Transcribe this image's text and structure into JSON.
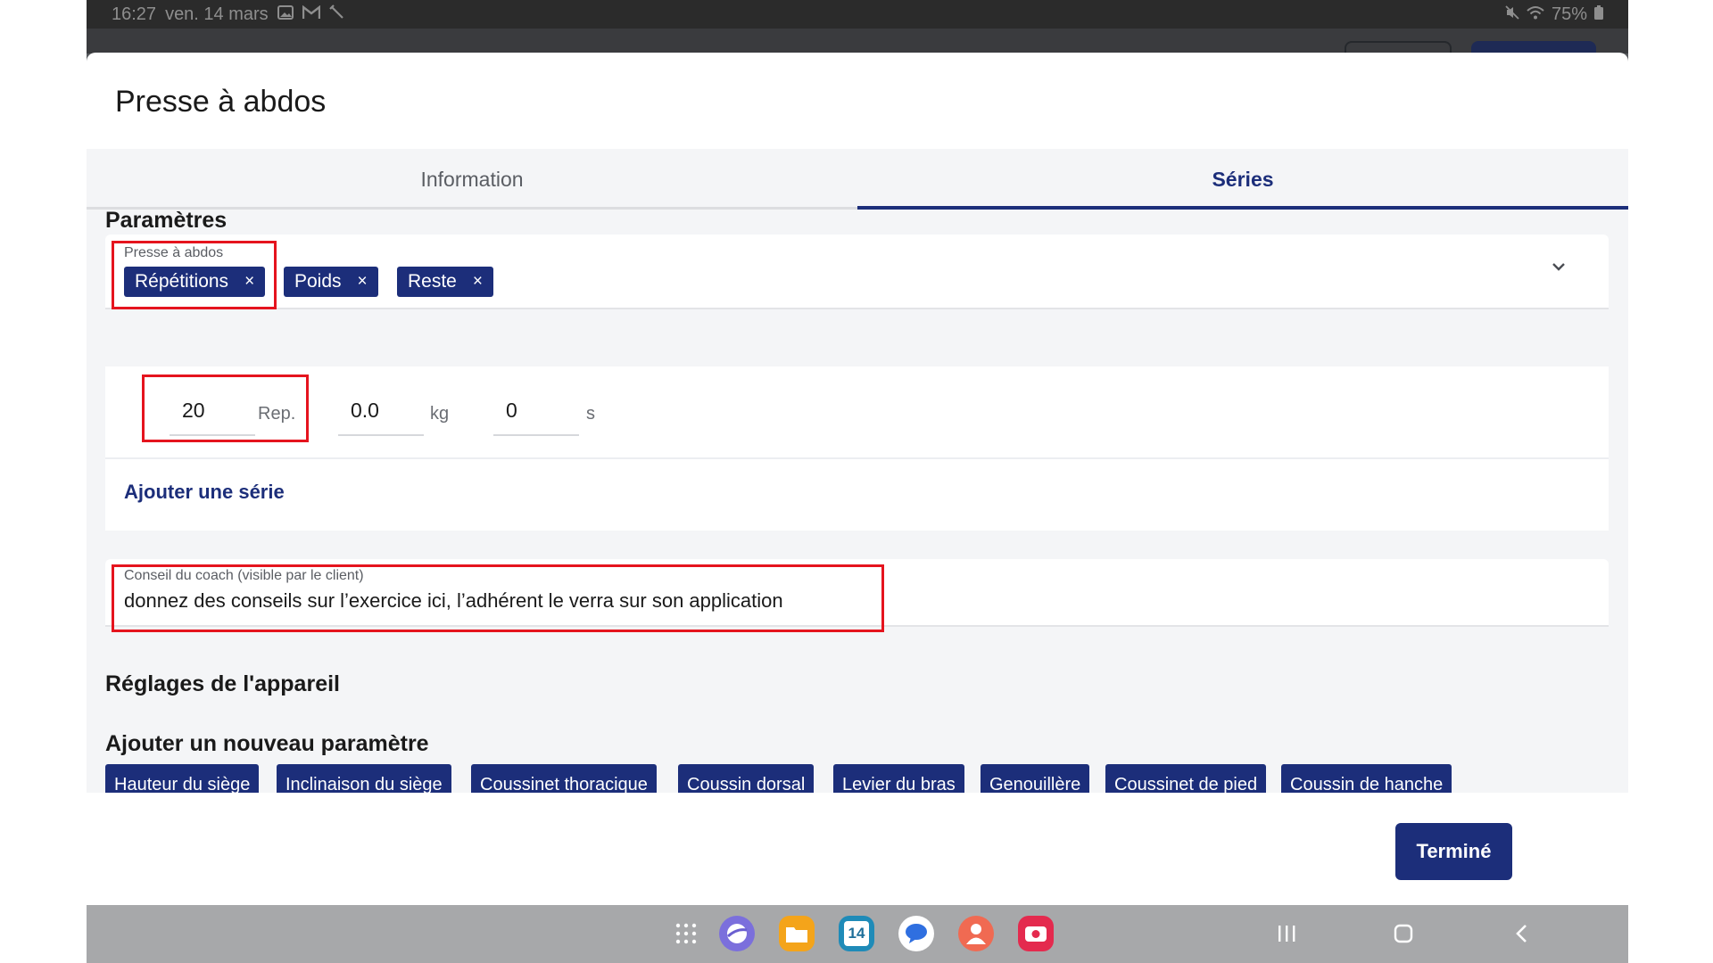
{
  "status_bar": {
    "time": "16:27",
    "date": "ven. 14 mars",
    "battery": "75%"
  },
  "modal": {
    "title": "Presse à abdos"
  },
  "tabs": [
    {
      "label": "Information",
      "active": false
    },
    {
      "label": "Séries",
      "active": true
    }
  ],
  "parameters": {
    "heading": "Paramètres",
    "field_label": "Presse à abdos",
    "chips": [
      "Répétitions",
      "Poids",
      "Reste"
    ],
    "chip_remove": "×"
  },
  "series": {
    "fields": [
      {
        "value": "20",
        "unit": "Rep."
      },
      {
        "value": "0.0",
        "unit": "kg"
      },
      {
        "value": "0",
        "unit": "s"
      }
    ],
    "add_label": "Ajouter une série"
  },
  "coach_advice": {
    "label": "Conseil du coach (visible par le client)",
    "text": "donnez des conseils sur l’exercice ici, l’adhérent le verra sur son application"
  },
  "device_settings": {
    "heading": "Réglages de l'appareil",
    "add_heading": "Ajouter un nouveau paramètre",
    "chips": [
      "Hauteur du siège",
      "Inclinaison du siège",
      "Coussinet thoracique",
      "Coussin dorsal",
      "Levier du bras",
      "Genouillère",
      "Coussinet de pied",
      "Coussin de hanche"
    ]
  },
  "footer": {
    "done_label": "Terminé"
  },
  "nav_bar": {
    "calendar_day": "14"
  },
  "colors": {
    "primary": "#1c2e7a",
    "highlight": "#e5141e",
    "background": "#f4f5f7"
  }
}
